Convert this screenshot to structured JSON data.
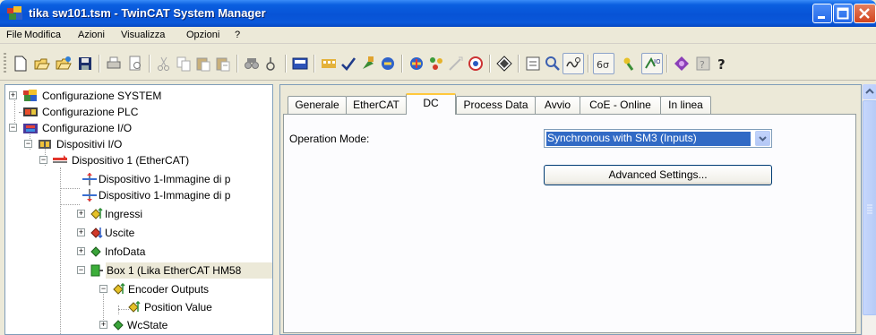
{
  "window": {
    "title": "tika sw101.tsm - TwinCAT System Manager",
    "accent": "#0a5fe0"
  },
  "menu": [
    "File",
    "Modifica",
    "Azioni",
    "Visualizza",
    "Opzioni",
    "?"
  ],
  "toolbar": {
    "icons": [
      "new-icon",
      "open-icon",
      "open-remote-icon",
      "save-icon",
      "print-icon",
      "print-preview-icon",
      "cut-icon",
      "copy-icon",
      "paste-icon",
      "paste-with-links-icon",
      "find-icon",
      "find-next-icon",
      "generate-mappings-icon",
      "check-configuration-icon",
      "activate-configuration-icon",
      "set-run-mode-icon",
      "set-config-mode-icon",
      "reload-devices-icon",
      "scan-devices-icon",
      "toggle-free-run-icon",
      "show-online-data-icon",
      "select-target-icon",
      "zoom-icon",
      "show-sub-items-icon",
      "oscilloscope-icon",
      "tree-view-icon",
      "io-icon",
      "about-icon",
      "help-icon"
    ]
  },
  "tree": {
    "nodes": [
      {
        "label": "Configurazione SYSTEM"
      },
      {
        "label": "Configurazione PLC"
      },
      {
        "label": "Configurazione I/O"
      },
      {
        "label": "Dispositivi I/O"
      },
      {
        "label": "Dispositivo 1 (EtherCAT)"
      },
      {
        "label": "Dispositivo 1-Immagine di p"
      },
      {
        "label": "Dispositivo 1-Immagine di p"
      },
      {
        "label": "Ingressi"
      },
      {
        "label": "Uscite"
      },
      {
        "label": "InfoData"
      },
      {
        "label": "Box 1 (Lika EtherCAT HM58"
      },
      {
        "label": "Encoder Outputs"
      },
      {
        "label": "Position Value"
      },
      {
        "label": "WcState"
      }
    ]
  },
  "tabs": [
    "Generale",
    "EtherCAT",
    "DC",
    "Process Data",
    "Avvio",
    "CoE - Online",
    "In linea"
  ],
  "active_tab": "DC",
  "dc": {
    "operation_mode_label": "Operation Mode:",
    "operation_mode_value": "Synchronous with SM3 (Inputs)",
    "advanced_button": "Advanced Settings..."
  }
}
